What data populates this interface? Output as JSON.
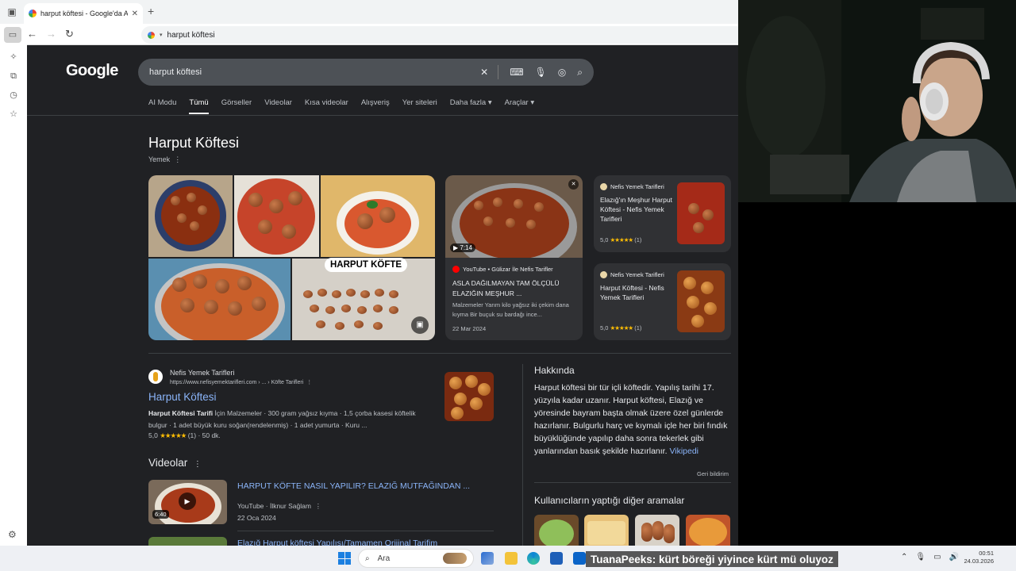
{
  "browser": {
    "tab_title": "harput köftesi - Google'da Ara",
    "address": "harput köftesi"
  },
  "google": {
    "query": "harput köftesi",
    "tabs": [
      "AI Modu",
      "Tümü",
      "Görseller",
      "Videolar",
      "Kısa videolar",
      "Alışveriş",
      "Yer siteleri",
      "Daha fazla",
      "Araçlar"
    ],
    "active_tab": "Tümü",
    "knowledge_title": "Harput Köftesi",
    "knowledge_subtitle": "Yemek",
    "collage_label": "HARPUT KÖFTE",
    "video_card": {
      "duration": "7:14",
      "source": "YouTube • Gülizar İle Nefis Tarifler",
      "title": "ASLA DAĞILMAYAN TAM ÖLÇÜLÜ ELAZIĞIN MEŞHUR ...",
      "desc": "Malzemeler Yarım kilo yağsız iki çekim dana kıyma Bir buçuk su bardağı ince...",
      "date": "22 Mar 2024"
    },
    "recipe_cards": [
      {
        "source": "Nefis Yemek Tarifleri",
        "title": "Elazığ'ın Meşhur Harput Köftesi - Nefis Yemek Tarifleri",
        "rating": "5,0",
        "count": "(1)"
      },
      {
        "source": "Nefis Yemek Tarifleri",
        "title": "Harput Köftesi - Nefis Yemek Tarifleri",
        "rating": "5,0",
        "count": "(1)"
      }
    ],
    "result": {
      "site": "Nefis Yemek Tarifleri",
      "url": "https://www.nefisyemektarifleri.com › ... › Köfte Tarifleri",
      "title": "Harput Köftesi",
      "snippet_bold": "Harput Köftesi Tarifi",
      "snippet_rest": " İçin Malzemeler · 300 gram yağsız kıyma · 1,5 çorba kasesi köftelik bulgur · 1 adet büyük kuru soğan(rendelenmiş) · 1 adet yumurta · Kuru ...",
      "rating": "5,0",
      "count": "(1) · 50 dk."
    },
    "videos_heading": "Videolar",
    "videos": [
      {
        "title": "HARPUT KÖFTE NASIL YAPILIR? ELAZIĞ MUTFAĞINDAN ...",
        "source": "YouTube · İlknur Sağlam",
        "date": "22 Oca 2024",
        "duration": "6:40"
      },
      {
        "title": "Elazığ Harput köftesi Yapılışı/Tamamen Orijinal Tarifim"
      }
    ],
    "about_heading": "Hakkında",
    "about_text": "Harput köftesi bir tür içli köftedir. Yapılış tarihi 17. yüzyıla kadar uzanır. Harput köftesi, Elazığ ve yöresinde bayram başta olmak üzere özel günlerde hazırlanır. Bulgurlu harç ve kıymalı içle her biri fındık büyüklüğünde yapılıp daha sonra tekerlek gibi yanlarından basık şekilde hazırlanır. ",
    "about_link": "Vikipedi",
    "feedback": "Geri bildirim",
    "related_heading": "Kullanıcıların yaptığı diğer aramalar"
  },
  "taskbar": {
    "search_placeholder": "Ara",
    "streamer": "TuanaPeeks",
    "chat": ": kürt böreği yiyince kürt mü oluyoz",
    "time": "00:51",
    "date": "24.03.2026"
  }
}
